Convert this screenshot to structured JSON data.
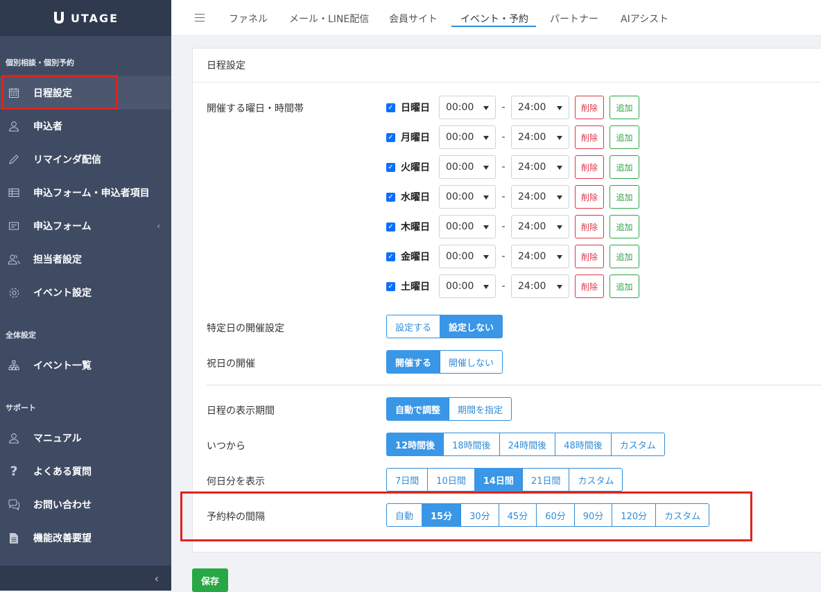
{
  "brand": {
    "name": "UTAGE"
  },
  "sidebar": {
    "sections": [
      "個別相談・個別予約",
      "全体設定",
      "サポート"
    ],
    "items": [
      {
        "label": "日程設定",
        "icon": "calendar-icon"
      },
      {
        "label": "申込者",
        "icon": "user-icon"
      },
      {
        "label": "リマインダ配信",
        "icon": "pencil-icon"
      },
      {
        "label": "申込フォーム・申込者項目",
        "icon": "table-icon"
      },
      {
        "label": "申込フォーム",
        "icon": "form-icon"
      },
      {
        "label": "担当者設定",
        "icon": "users-icon"
      },
      {
        "label": "イベント設定",
        "icon": "gear-icon"
      },
      {
        "label": "イベント一覧",
        "icon": "sitemap-icon"
      },
      {
        "label": "マニュアル",
        "icon": "user-icon"
      },
      {
        "label": "よくある質問",
        "icon": "question-icon"
      },
      {
        "label": "お問い合わせ",
        "icon": "chat-icon"
      },
      {
        "label": "機能改善要望",
        "icon": "document-icon"
      }
    ]
  },
  "topnav": {
    "tabs": [
      {
        "label": "ファネル"
      },
      {
        "label": "メール・LINE配信"
      },
      {
        "label": "会員サイト"
      },
      {
        "label": "イベント・予約"
      },
      {
        "label": "パートナー"
      },
      {
        "label": "AIアシスト"
      }
    ]
  },
  "card": {
    "title": "日程設定",
    "weekday_label": "開催する曜日・時間帯",
    "days": [
      {
        "day": "日曜日",
        "start": "00:00",
        "end": "24:00"
      },
      {
        "day": "月曜日",
        "start": "00:00",
        "end": "24:00"
      },
      {
        "day": "火曜日",
        "start": "00:00",
        "end": "24:00"
      },
      {
        "day": "水曜日",
        "start": "00:00",
        "end": "24:00"
      },
      {
        "day": "木曜日",
        "start": "00:00",
        "end": "24:00"
      },
      {
        "day": "金曜日",
        "start": "00:00",
        "end": "24:00"
      },
      {
        "day": "土曜日",
        "start": "00:00",
        "end": "24:00"
      }
    ],
    "dash": "-",
    "delete_label": "削除",
    "add_label": "追加",
    "specific_day": {
      "label": "特定日の開催設定",
      "options": [
        "設定する",
        "設定しない"
      ]
    },
    "holiday": {
      "label": "祝日の開催",
      "options": [
        "開催する",
        "開催しない"
      ]
    },
    "display_period": {
      "label": "日程の表示期間",
      "options": [
        "自動で調整",
        "期間を指定"
      ]
    },
    "from": {
      "label": "いつから",
      "options": [
        "12時間後",
        "18時間後",
        "24時間後",
        "48時間後",
        "カスタム"
      ]
    },
    "days_shown": {
      "label": "何日分を表示",
      "options": [
        "7日間",
        "10日間",
        "14日間",
        "21日間",
        "カスタム"
      ]
    },
    "interval": {
      "label": "予約枠の間隔",
      "options": [
        "自動",
        "15分",
        "30分",
        "45分",
        "60分",
        "90分",
        "120分",
        "カスタム"
      ]
    }
  },
  "save_label": "保存"
}
